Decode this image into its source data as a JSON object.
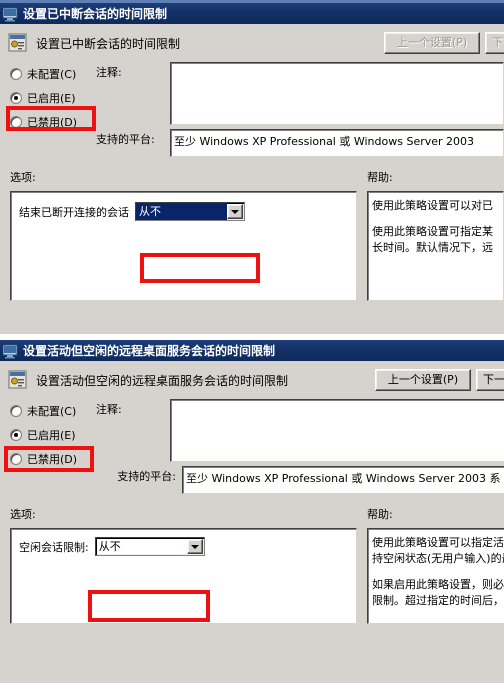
{
  "windows": [
    {
      "id": "disconnected-session-limit",
      "title": "设置已中断会话的时间限制",
      "header_title": "设置已中断会话的时间限制",
      "icon": "gpedit-policy-icon",
      "nav": {
        "prev_label": "上一个设置(P)",
        "prev_disabled": true,
        "next_label": "下",
        "next_disabled": true
      },
      "radios": [
        {
          "label": "未配置(C)",
          "selected": false
        },
        {
          "label": "已启用(E)",
          "selected": true
        },
        {
          "label": "已禁用(D)",
          "selected": false
        }
      ],
      "comment_label": "注释:",
      "comment_value": "",
      "platform_label": "支持的平台:",
      "platform_value": "至少 Windows XP Professional 或 Windows Server 2003",
      "options_label": "选项:",
      "help_label": "帮助:",
      "option_row_label": "结束已断开连接的会话",
      "option_value": "从不",
      "option_focused": true,
      "help_lines": [
        "使用此策略设置可以对已",
        "",
        "使用此策略设置可指定某",
        "长时间。默认情况下，远"
      ]
    },
    {
      "id": "active-idle-session-limit",
      "title": "设置活动但空闲的远程桌面服务会话的时间限制",
      "header_title": "设置活动但空闲的远程桌面服务会话的时间限制",
      "icon": "gpedit-policy-icon",
      "nav": {
        "prev_label": "上一个设置(P)",
        "prev_disabled": false,
        "next_label": "下一",
        "next_disabled": false
      },
      "radios": [
        {
          "label": "未配置(C)",
          "selected": false
        },
        {
          "label": "已启用(E)",
          "selected": true
        },
        {
          "label": "已禁用(D)",
          "selected": false
        }
      ],
      "comment_label": "注释:",
      "comment_value": "",
      "platform_label": "支持的平台:",
      "platform_value": "至少 Windows XP Professional 或 Windows Server 2003 系",
      "options_label": "选项:",
      "help_label": "帮助:",
      "option_row_label": "空闲会话限制:",
      "option_value": "从不",
      "option_focused": false,
      "help_lines": [
        "使用此策略设置可以指定活",
        "持空闲状态(无用户输入)的最",
        "",
        "如果启用此策略设置，则必",
        "限制。超过指定的时间后，"
      ]
    }
  ],
  "colors": {
    "titlebar": "#13316a",
    "face": "#d6d3ce",
    "highlight_red": "#ee1111",
    "selection_blue": "#0a246a"
  }
}
